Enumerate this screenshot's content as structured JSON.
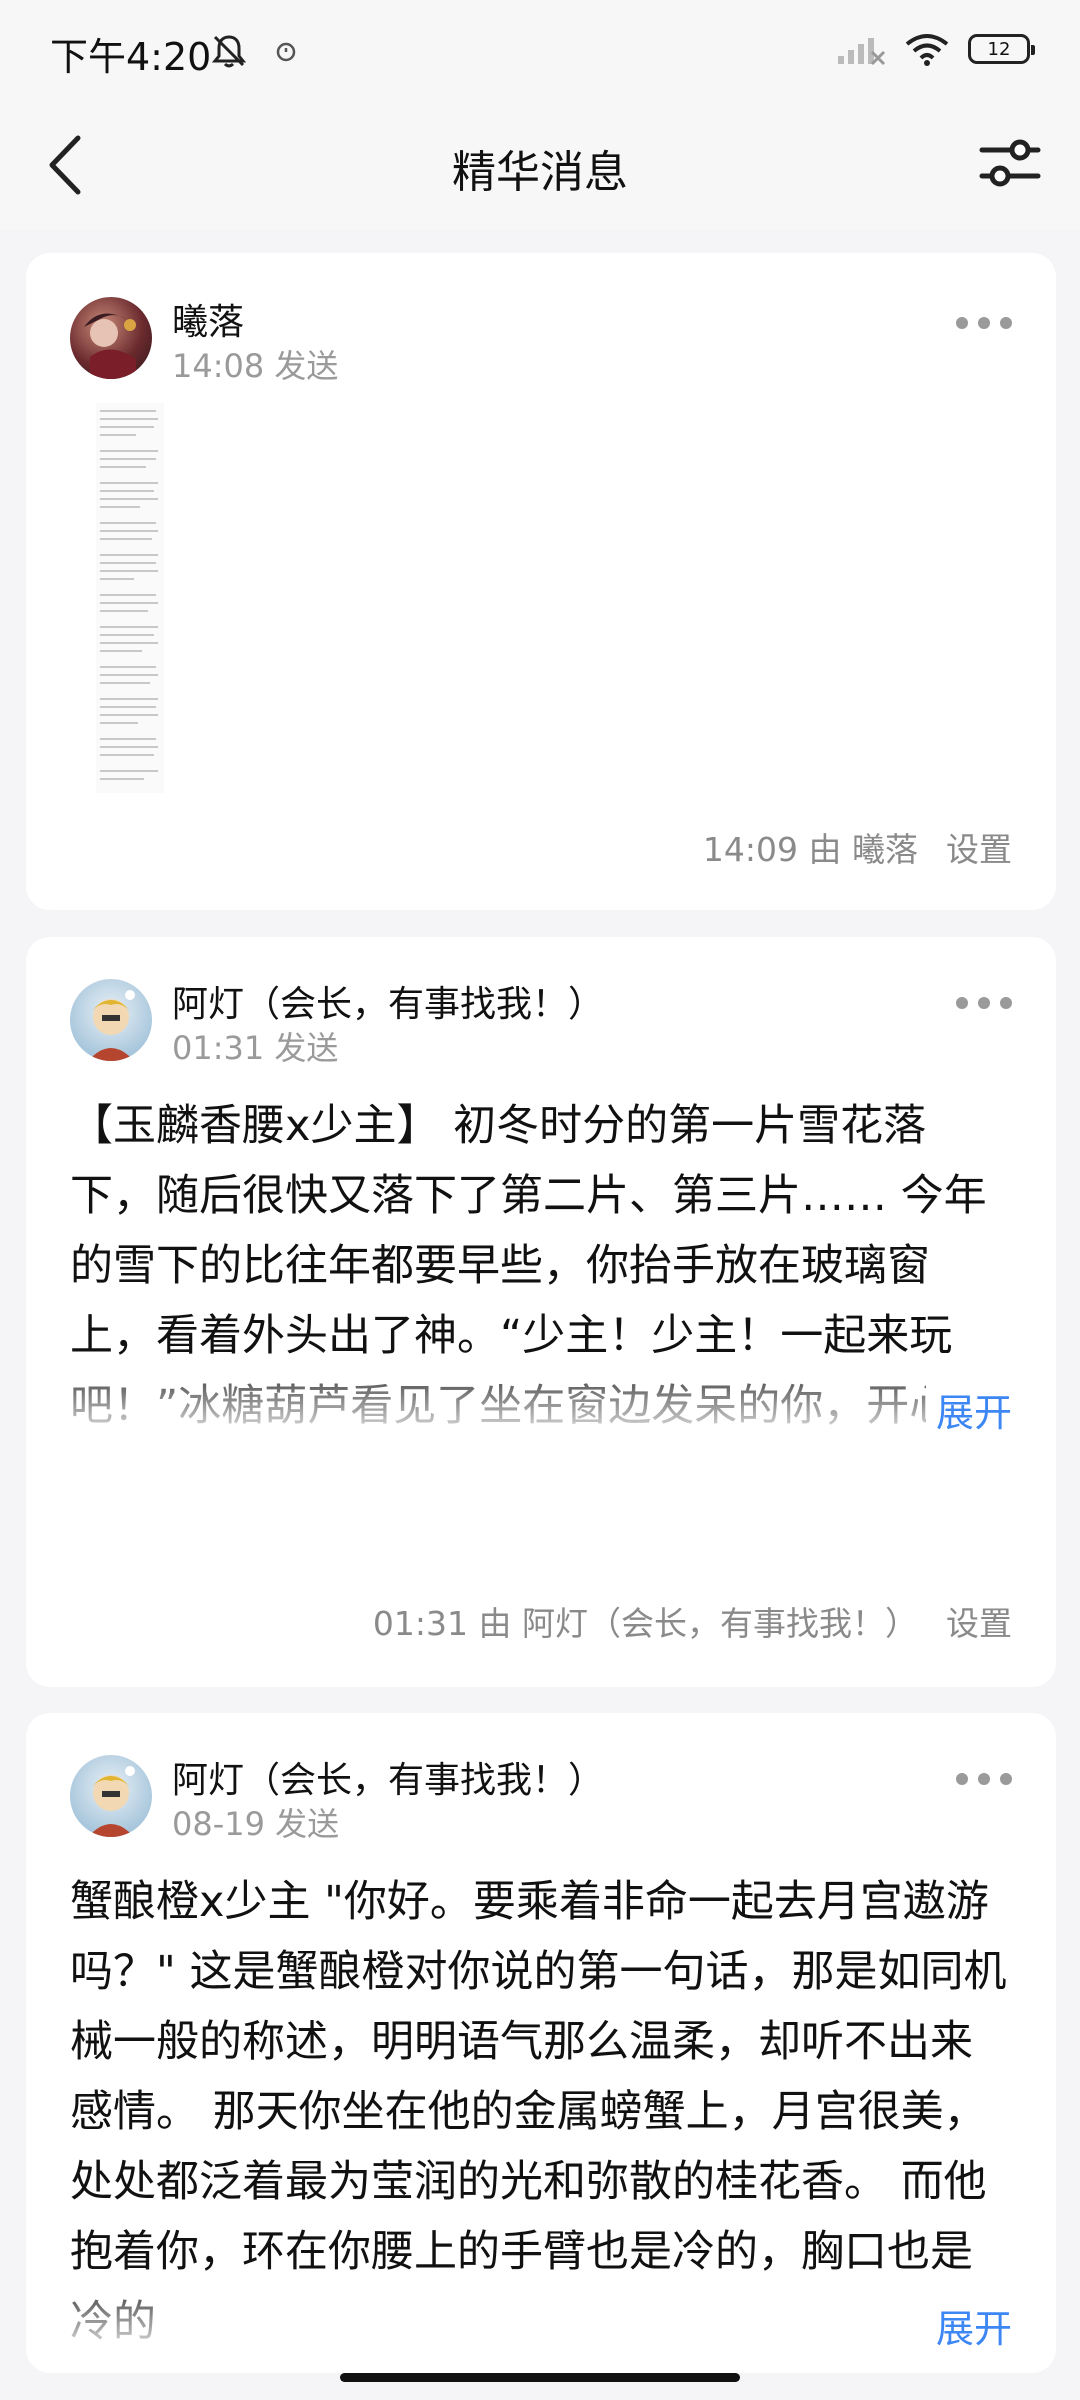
{
  "status_bar": {
    "time": "下午4:20",
    "battery": "12",
    "icons": [
      "mute-bell-icon",
      "alarm-icon",
      "signal-icon",
      "wifi-icon",
      "battery-icon"
    ]
  },
  "nav": {
    "title": "精华消息",
    "back_icon": "chevron-left-icon",
    "filter_icon": "sliders-icon"
  },
  "messages": [
    {
      "sender": "曦落",
      "sent": "14:08 发送",
      "type": "image",
      "setter_info": "14:09 由 曦落",
      "set_label": "设置"
    },
    {
      "sender": "阿灯（会长，有事找我！）",
      "sent": "01:31 发送",
      "type": "text",
      "text": "【玉麟香腰x少主】 初冬时分的第一片雪花落下，随后很快又落下了第二片、第三片…… 今年的雪下的比往年都要早些，你抬手放在玻璃窗上，看着外头出了神。“少主！少主！一起来玩吧！”冰糖葫芦看见了坐在窗边发呆的你，开心的挥舞着手喊着。“青团也想要和少主一起玩～”青团睡眼",
      "expand_label": "展开",
      "setter_info": "01:31 由 阿灯（会长，有事找我！）",
      "set_label": "设置"
    },
    {
      "sender": "阿灯（会长，有事找我！）",
      "sent": "08-19 发送",
      "type": "text",
      "text": "蟹酿橙x少主 \"你好。要乘着非命一起去月宫遨游吗？\" 这是蟹酿橙对你说的第一句话，那是如同机械一般的称述，明明语气那么温柔，却听不出来感情。 那天你坐在他的金属螃蟹上，月宫很美，处处都泛着最为莹润的光和弥散的桂花香。 而他抱着你，环在你腰上的手臂也是冷的，胸口也是冷的",
      "expand_label": "展开"
    }
  ],
  "colors": {
    "background": "#f5f5f7",
    "card": "#ffffff",
    "accent": "#3d87f5",
    "secondary_text": "#9a9a9a"
  }
}
